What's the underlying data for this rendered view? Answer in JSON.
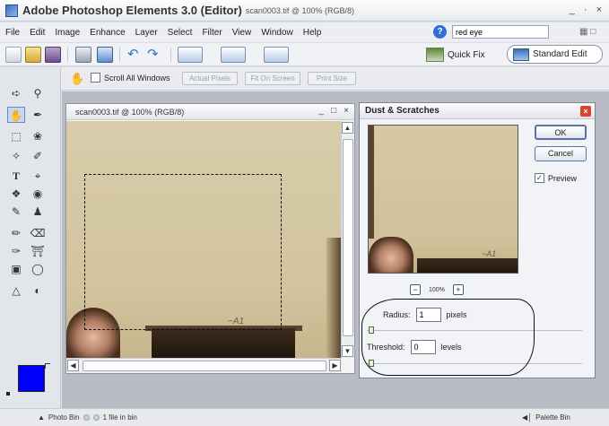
{
  "window": {
    "app_title": "Adobe Photoshop Elements 3.0 (Editor)",
    "doc_info": "scan0003.tif @ 100% (RGB/8)",
    "controls": [
      "_",
      "·",
      "×"
    ]
  },
  "menu": [
    "File",
    "Edit",
    "Image",
    "Enhance",
    "Layer",
    "Select",
    "Filter",
    "View",
    "Window",
    "Help"
  ],
  "help_search": {
    "value": "red eye",
    "icon": "help-icon"
  },
  "toolbar": {
    "quick_fix_label": "Quick Fix",
    "standard_edit_label": "Standard Edit"
  },
  "options_bar": {
    "scroll_all_label": "Scroll All Windows",
    "scroll_all_checked": false,
    "actual_pixels_label": "Actual Pixels",
    "fit_on_screen_label": "Fit On Screen",
    "print_size_label": "Print Size"
  },
  "document": {
    "title": "scan0003.tif @ 100% (RGB/8)",
    "controls": [
      "_",
      "□",
      "×"
    ]
  },
  "dialog": {
    "title": "Dust & Scratches",
    "ok_label": "OK",
    "cancel_label": "Cancel",
    "preview_label": "Preview",
    "preview_checked": true,
    "zoom": "100%",
    "radius_label": "Radius:",
    "radius_value": "1",
    "radius_unit": "pixels",
    "threshold_label": "Threshold:",
    "threshold_value": "0",
    "threshold_unit": "levels"
  },
  "status": {
    "photo_bin_label": "Photo Bin",
    "bin_count": "1 file in bin",
    "palette_bin_label": "Palette Bin"
  },
  "colors": {
    "foreground": "#0000ff",
    "accent": "#2f6fd6"
  }
}
